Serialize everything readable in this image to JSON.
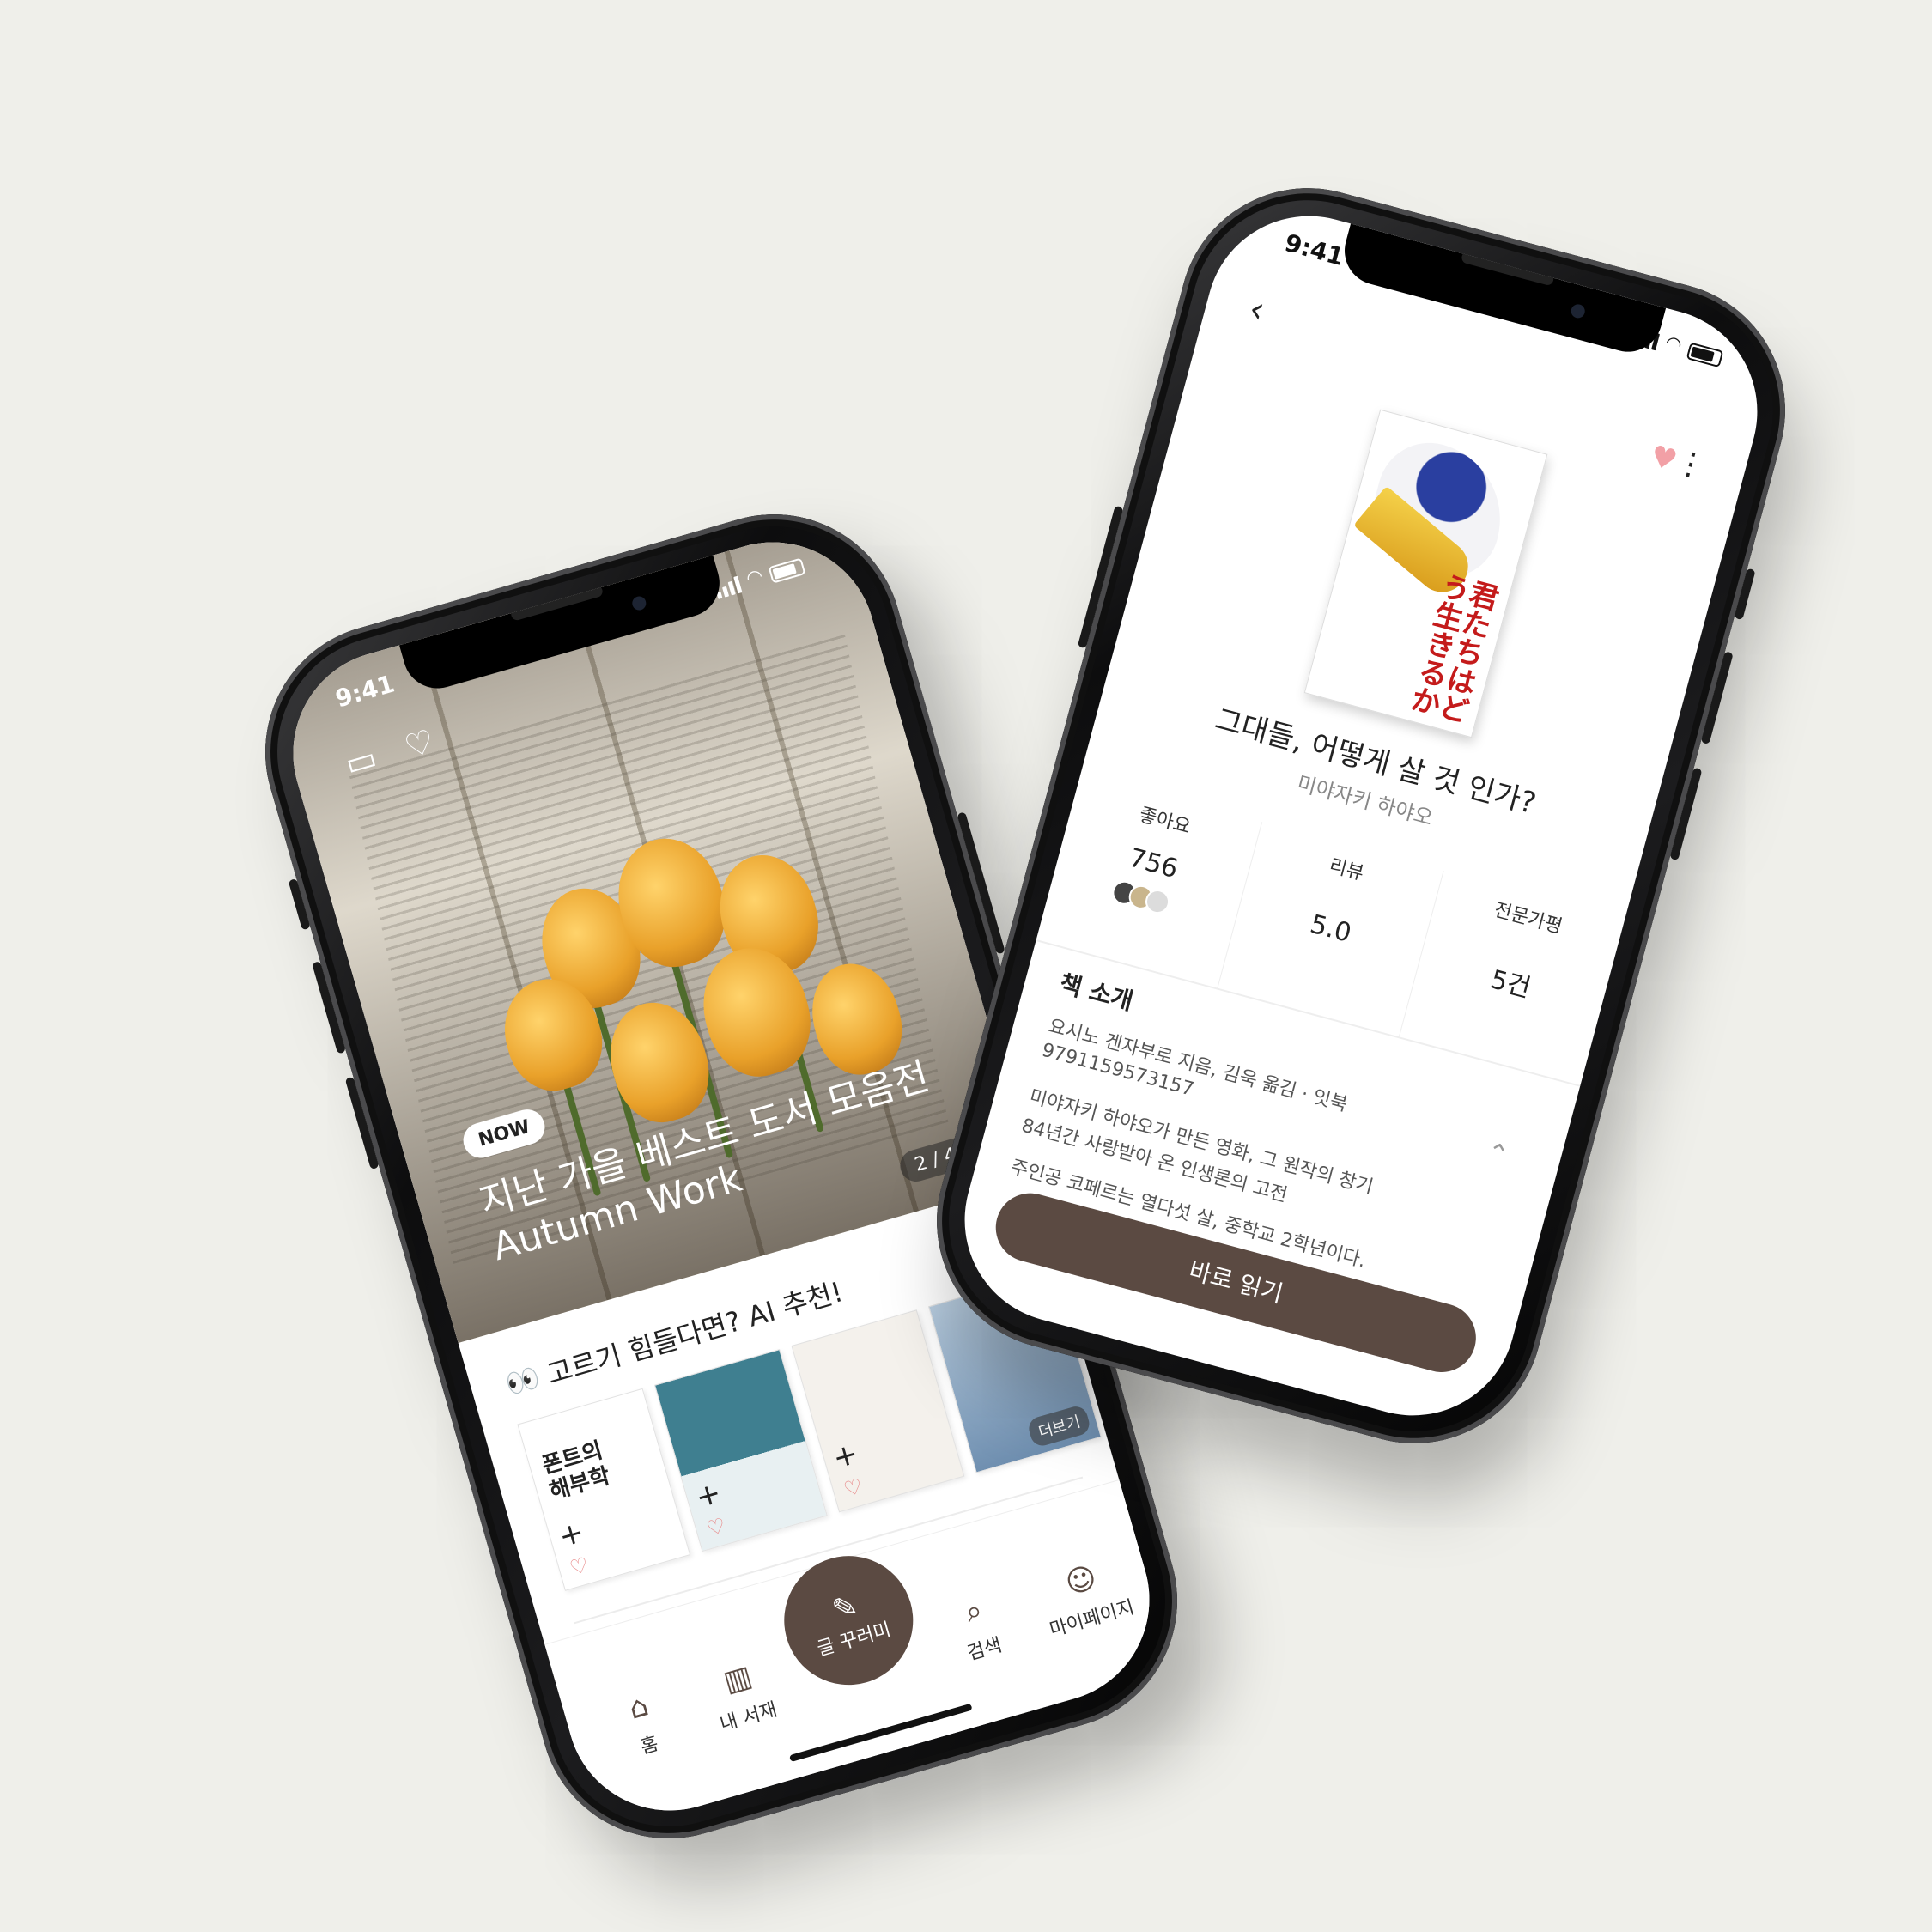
{
  "phone1": {
    "status": {
      "time": "9:41"
    },
    "hero": {
      "badge": "NOW",
      "title": "지난 가을 베스트 도서 모음전",
      "subtitle": "Autumn Work",
      "pager": "2 / 4"
    },
    "ai_section": {
      "emoji": "👀",
      "title": "고르기 힘들다면? AI 추천!"
    },
    "books": [
      {
        "title": "폰트의\n해부학"
      },
      {
        "title": ""
      },
      {
        "title": ""
      },
      {
        "title": "",
        "more_label": "더보기"
      }
    ],
    "tabbar": {
      "home": "홈",
      "library": "내 서재",
      "write": "글 꾸러미",
      "search": "검색",
      "mypage": "마이페이지"
    },
    "colors": {
      "accent": "#5b4a42",
      "heart": "#e88a8a"
    }
  },
  "phone2": {
    "status": {
      "time": "9:41"
    },
    "cover_text": "君たちはどう生きるか",
    "title": "그대들, 어떻게 살 것 인가?",
    "author": "미야자키 하야오",
    "stats": [
      {
        "label": "좋아요",
        "value": "756"
      },
      {
        "label": "리뷰",
        "value": "5.0"
      },
      {
        "label": "전문가평",
        "value": "5건"
      }
    ],
    "intro": {
      "heading": "책 소개",
      "lines": [
        "요시노 겐자부로 지음, 김욱 옮김 · 잇북",
        "9791159573157",
        "미야자키 하야오가 만든 영화, 그 원작의 창기",
        "84년간 사랑받아 온 인생론의 고전",
        "주인공 코페르는 열다섯 살, 중학교 2학년이다."
      ]
    },
    "read_button": "바로 읽기",
    "colors": {
      "accent": "#5b4a42",
      "heart": "#f2a0a6",
      "cover_red": "#c41b1b"
    }
  }
}
